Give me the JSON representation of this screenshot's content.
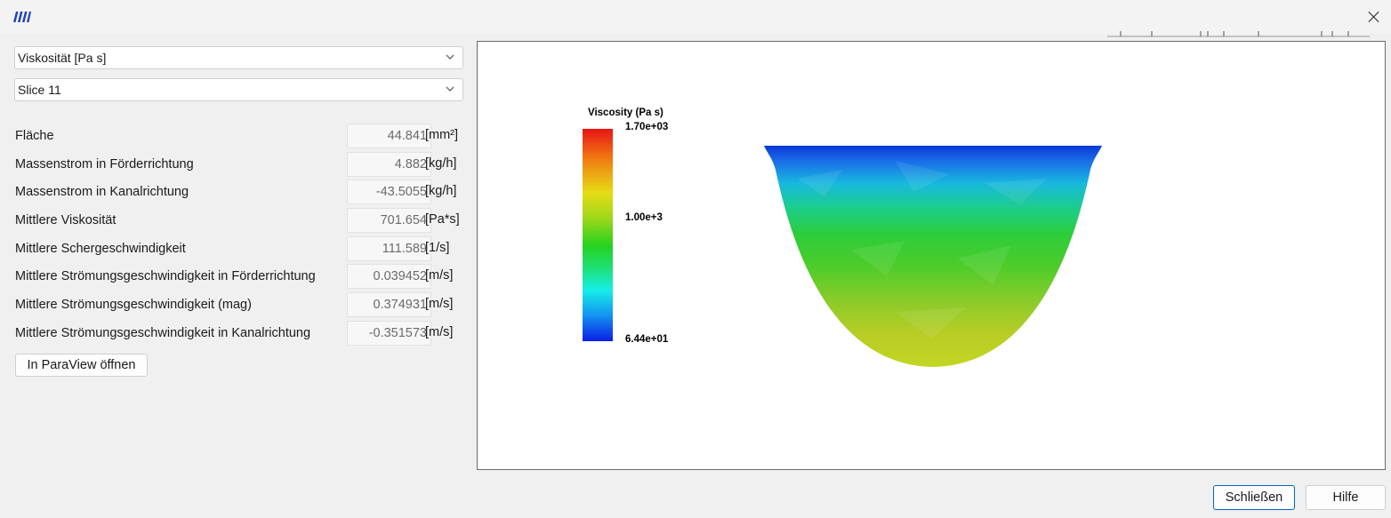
{
  "controls": {
    "field_select": "Viskosität [Pa s]",
    "slice_select": "Slice 11"
  },
  "results": [
    {
      "label": "Fläche",
      "value": "44.841",
      "unit": "[mm²]"
    },
    {
      "label": "Massenstrom in Förderrichtung",
      "value": "4.882",
      "unit": "[kg/h]"
    },
    {
      "label": "Massenstrom in Kanalrichtung",
      "value": "-43.5055",
      "unit": "[kg/h]"
    },
    {
      "label": "Mittlere Viskosität",
      "value": "701.654",
      "unit": "[Pa*s]"
    },
    {
      "label": "Mittlere Schergeschwindigkeit",
      "value": "111.589",
      "unit": "[1/s]"
    },
    {
      "label": "Mittlere Strömungsgeschwindigkeit in Förderrichtung",
      "value": "0.039452",
      "unit": "[m/s]"
    },
    {
      "label": "Mittlere Strömungsgeschwindigkeit (mag)",
      "value": "0.374931",
      "unit": "[m/s]"
    },
    {
      "label": "Mittlere Strömungsgeschwindigkeit in Kanalrichtung",
      "value": "-0.351573",
      "unit": "[m/s]"
    }
  ],
  "buttons": {
    "paraview": "In ParaView öffnen",
    "close": "Schließen",
    "help": "Hilfe"
  },
  "colorbar": {
    "title": "Viscosity (Pa s)",
    "max_label": "1.70e+03",
    "mid_label": "1.00e+3",
    "min_label": "6.44e+01"
  },
  "icons": {
    "app": "screw-logo-icon",
    "close": "close-icon",
    "dropdown": "chevron-down-icon"
  },
  "colors": {
    "accent_border": "#0067c0",
    "logo": "#1f3fbf"
  }
}
